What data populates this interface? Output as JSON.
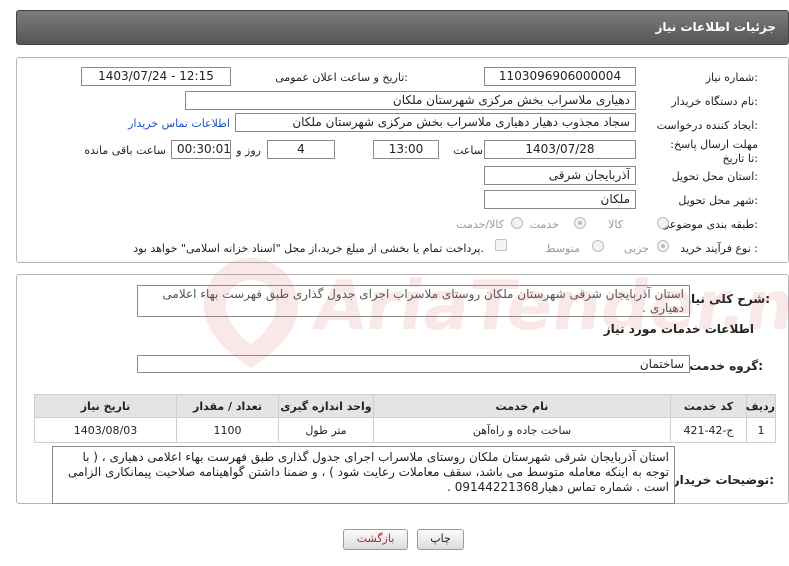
{
  "header": {
    "title": "جزئیات اطلاعات نیاز"
  },
  "form": {
    "need_number": {
      "label": "شماره نیاز:",
      "value": "1103096906000004"
    },
    "announce_datetime": {
      "label": "تاریخ و ساعت اعلان عمومی:",
      "value": "1403/07/24 - 12:15"
    },
    "buyer_org": {
      "label": "نام دستگاه خریدار:",
      "value": "دهیاری ملاسراب بخش مرکزی شهرستان ملکان"
    },
    "requester": {
      "label": "ایجاد کننده درخواست:",
      "value": "سجاد مجذوب دهیار دهیاری ملاسراب بخش مرکزی شهرستان ملکان",
      "contact_link": "اطلاعات تماس خریدار"
    },
    "deadline": {
      "label": "مهلت ارسال پاسخ: تا تاریخ:",
      "date": "1403/07/28",
      "time_label": "ساعت",
      "time": "13:00",
      "days": "4",
      "days_label": "روز و",
      "remaining": "00:30:01",
      "remaining_label": "ساعت باقی مانده"
    },
    "province": {
      "label": "استان محل تحویل:",
      "value": "آذربایجان شرقی"
    },
    "city": {
      "label": "شهر محل تحویل:",
      "value": "ملکان"
    },
    "category": {
      "label": "طبقه بندی موضوعی:",
      "options": [
        "کالا",
        "خدمت",
        "کالا/خدمت"
      ],
      "selected": "خدمت"
    },
    "process": {
      "label": "نوع فرآیند خرید :",
      "options": [
        "جزیی",
        "متوسط"
      ],
      "selected": "جزیی",
      "payment_note": "پرداخت تمام یا بخشی از مبلغ خرید،از محل \"اسناد خزانه اسلامی\" خواهد بود."
    }
  },
  "summary": {
    "label": "شرح کلی نیاز:",
    "text": "استان آذربایجان شرقی شهرستان ملکان روستای ملاسراب اجرای جدول گذاری طبق فهرست بهاء اعلامی دهیاری ."
  },
  "services": {
    "title": "اطلاعات خدمات مورد نیاز",
    "group_label": "گروه خدمت:",
    "group_value": "ساختمان",
    "table": {
      "headers": [
        "ردیف",
        "کد خدمت",
        "نام خدمت",
        "واحد اندازه گیری",
        "تعداد / مقدار",
        "تاریخ نیاز"
      ],
      "rows": [
        [
          "1",
          "ج-42-421",
          "ساخت جاده و راه‌آهن",
          "متر طول",
          "1100",
          "1403/08/03"
        ]
      ]
    }
  },
  "buyer_notes": {
    "label": "توضیحات خریدار:",
    "text": "استان آذربایجان شرقی شهرستان ملکان روستای ملاسراب اجرای جدول گذاری طبق فهرست بهاء اعلامی دهیاری ، ( با توجه به اینکه معامله متوسط می باشد، سقف معاملات رعایت شود ) ، و ضمنا داشتن گواهینامه صلاحیت پیمانکاری الزامی است . شماره تماس دهیار09144221368 ."
  },
  "buttons": {
    "print": "چاپ",
    "back": "بازگشت"
  },
  "watermark": {
    "text": "AriaTender.net"
  }
}
